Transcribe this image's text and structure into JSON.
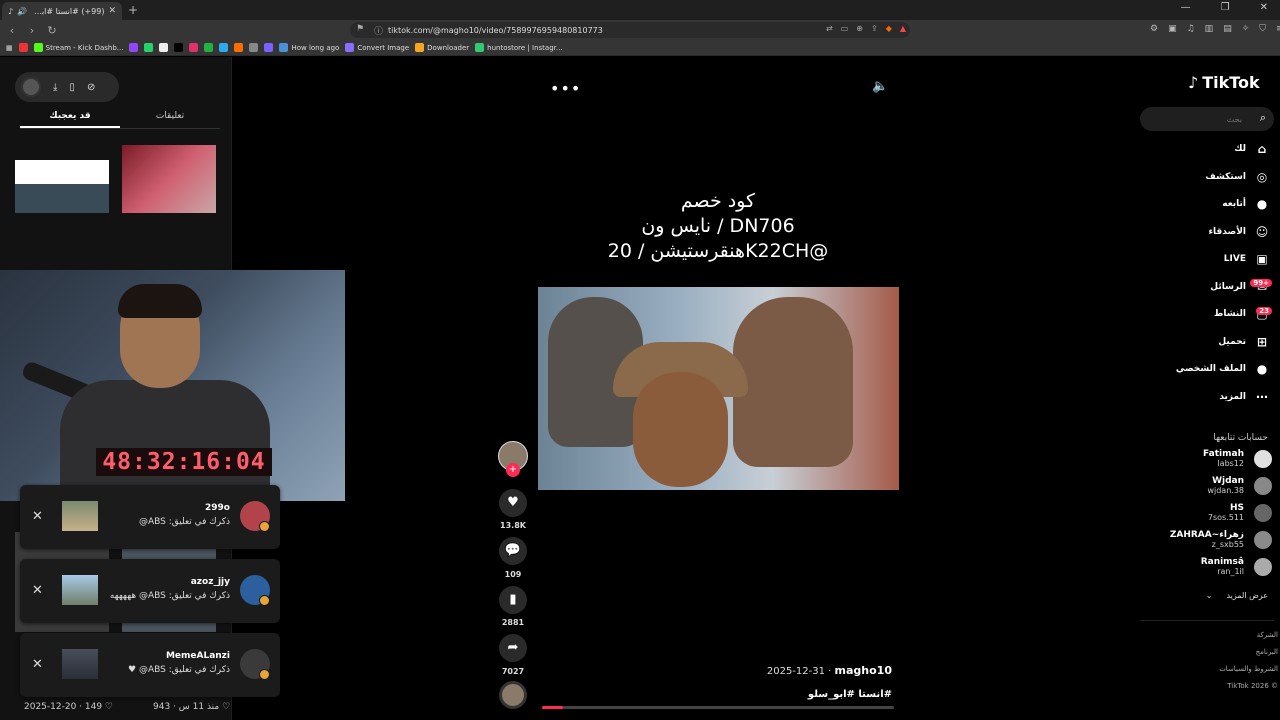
{
  "browser": {
    "tab_title": "(99+) #انستا #ابو_سلو | ابو سلو",
    "tab_close": "✕",
    "new_tab": "+",
    "url": "tiktok.com/@magho10/video/7589976959480810773",
    "bookmarks": [
      {
        "label": "",
        "color": "#e33"
      },
      {
        "label": "Stream - Kick Dashb...",
        "color": "#53fc18"
      },
      {
        "label": "",
        "color": "#9146ff"
      },
      {
        "label": "",
        "color": "#25d366"
      },
      {
        "label": "",
        "color": "#eee"
      },
      {
        "label": "",
        "color": "#000"
      },
      {
        "label": "",
        "color": "#e1306c"
      },
      {
        "label": "",
        "color": "#1fb141"
      },
      {
        "label": "",
        "color": "#2aabee"
      },
      {
        "label": "",
        "color": "#ff6d00"
      },
      {
        "label": "",
        "color": "#888"
      },
      {
        "label": "",
        "color": "#7b61ff"
      },
      {
        "label": "How long ago",
        "color": "#4a90d9"
      },
      {
        "label": "Convert Image",
        "color": "#8a6cff"
      },
      {
        "label": "Downloader",
        "color": "#f5a623"
      },
      {
        "label": "huntostore | Instagr...",
        "color": "#2ecc71"
      }
    ]
  },
  "left_panel": {
    "tabs": {
      "comments": "تعليقات",
      "you_may_like": "قد يعجبك"
    },
    "timer": "48:32:16:04",
    "footer_date": "2025-12-20 · 149 ♡",
    "footer_right": "منذ 11 س · 943 ♡"
  },
  "notifications": [
    {
      "user": "299o",
      "text": "ذكرك في تعليق: ABS@"
    },
    {
      "user": "azoz_jjy",
      "text": "ذكرك في تعليق: ABS@ هههههه"
    },
    {
      "user": "MemeALanzi",
      "text": "ذكرك في تعليق: ABS@ ♥"
    }
  ],
  "video": {
    "caption_line1": "كود خصم",
    "caption_line2": "نايس ون / DN706",
    "caption_line3": "هنقرستيشن / 20K22CH@",
    "likes": "13.8K",
    "comments": "109",
    "saves": "2881",
    "shares": "7027",
    "author": "magho10",
    "date": "2025-12-31",
    "hashtags": "#انستا #ابو_سلو",
    "progress_fraction": 0.06
  },
  "right_nav": {
    "logo": "TikTok",
    "search_placeholder": "بحث",
    "items": [
      {
        "label": "لك",
        "icon": "⌂"
      },
      {
        "label": "استكشف",
        "icon": "◎"
      },
      {
        "label": "أتابعه",
        "icon": "●"
      },
      {
        "label": "الأصدقاء",
        "icon": "☺"
      },
      {
        "label": "LIVE",
        "icon": "▣"
      },
      {
        "label": "الرسائل",
        "icon": "✉"
      },
      {
        "label": "النشاط",
        "icon": "▢"
      },
      {
        "label": "تحميل",
        "icon": "⊞"
      },
      {
        "label": "الملف الشخصي",
        "icon": "●"
      },
      {
        "label": "المزيد",
        "icon": "⋯"
      }
    ],
    "messages_badge": "99+",
    "activity_badge": "23",
    "following_header": "حسابات تتابعها",
    "following": [
      {
        "name": "Fatimah",
        "handle": "labs12"
      },
      {
        "name": "Wjdan",
        "handle": "wjdan.38"
      },
      {
        "name": "HS",
        "handle": "7sos.511"
      },
      {
        "name": "ZAHRAA~زهراء",
        "handle": "z_sxb55"
      },
      {
        "name": "Ranimsâ",
        "handle": "ran_1il"
      }
    ],
    "show_more": "عرض المزيد",
    "footer": [
      "الشركة",
      "البرنامج",
      "الشروط والسياسات",
      "TikTok 2026 ©"
    ]
  }
}
